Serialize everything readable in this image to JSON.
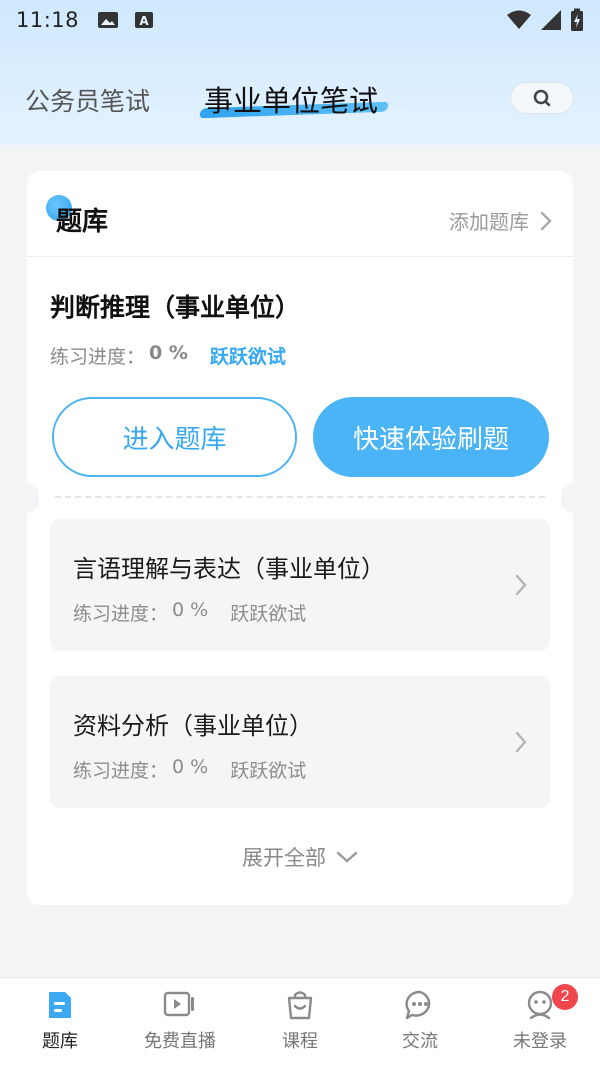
{
  "status": {
    "time": "11:18"
  },
  "header": {
    "tabs": [
      {
        "label": "公务员笔试"
      },
      {
        "label": "事业单位笔试"
      }
    ]
  },
  "card": {
    "title": "题库",
    "add_label": "添加题库",
    "main": {
      "title": "判断推理（事业单位）",
      "progress_label": "练习进度：",
      "progress_value": "0 %",
      "tag": "跃跃欲试",
      "enter_button": "进入题库",
      "quick_button": "快速体验刷题"
    },
    "items": [
      {
        "title": "言语理解与表达（事业单位）",
        "progress_label": "练习进度：",
        "progress_value": "0 %",
        "tag": "跃跃欲试"
      },
      {
        "title": "资料分析（事业单位）",
        "progress_label": "练习进度：",
        "progress_value": "0 %",
        "tag": "跃跃欲试"
      }
    ],
    "expand_label": "展开全部"
  },
  "tabbar": {
    "items": [
      {
        "label": "题库",
        "icon": "question-bank-icon"
      },
      {
        "label": "免费直播",
        "icon": "live-video-icon"
      },
      {
        "label": "课程",
        "icon": "course-bag-icon"
      },
      {
        "label": "交流",
        "icon": "chat-icon"
      },
      {
        "label": "未登录",
        "icon": "user-face-icon",
        "badge": "2"
      }
    ]
  },
  "colors": {
    "accent": "#4bb4f6",
    "badge": "#f0474d"
  }
}
